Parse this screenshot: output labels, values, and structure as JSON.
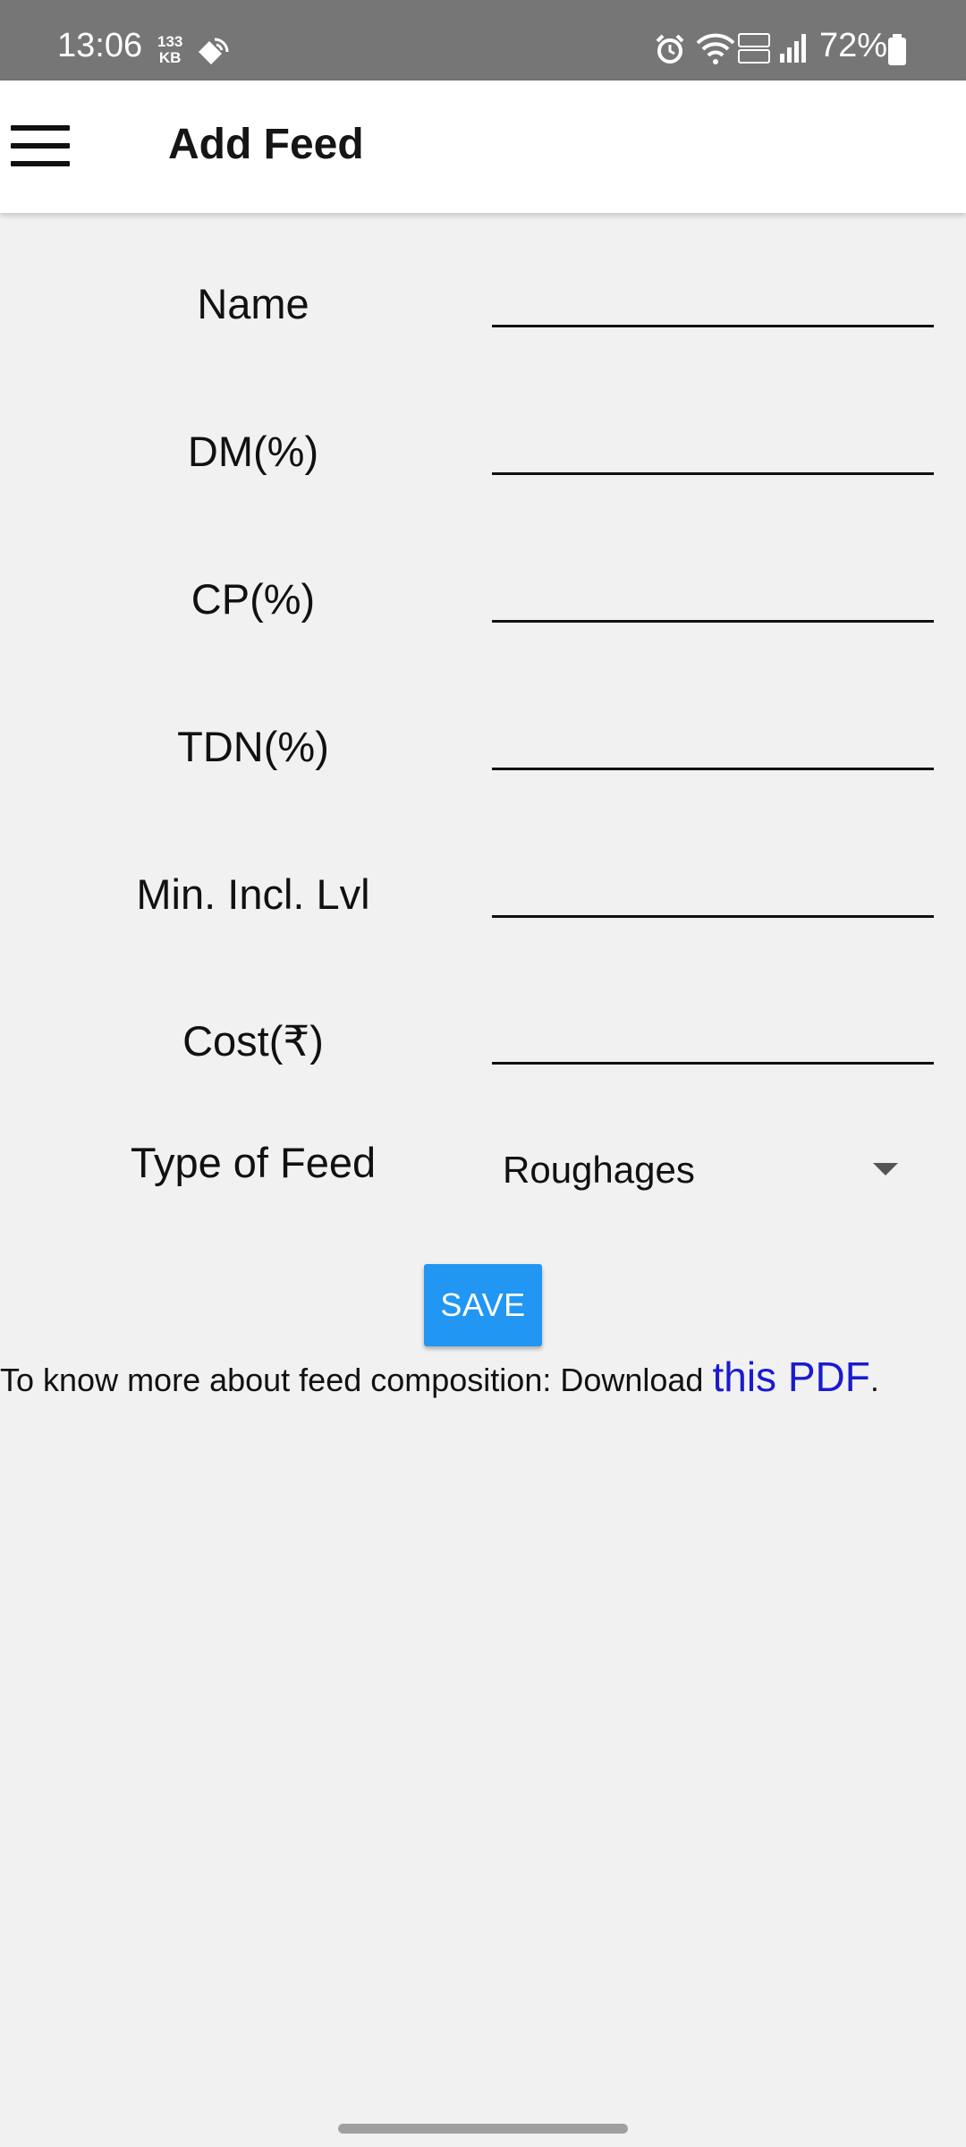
{
  "status_bar": {
    "time": "13:06",
    "data_rate_value": "133",
    "data_rate_unit": "KB",
    "battery_percent": "72%"
  },
  "app_bar": {
    "title": "Add Feed"
  },
  "form": {
    "fields": [
      {
        "label": "Name",
        "value": ""
      },
      {
        "label": "DM(%)",
        "value": ""
      },
      {
        "label": "CP(%)",
        "value": ""
      },
      {
        "label": "TDN(%)",
        "value": ""
      },
      {
        "label": "Min. Incl. Lvl",
        "value": ""
      },
      {
        "label": "Cost(₹)",
        "value": ""
      }
    ],
    "type_of_feed": {
      "label": "Type of Feed",
      "selected": "Roughages"
    },
    "save_label": "SAVE"
  },
  "info": {
    "prefix": "To know more about feed composition: Download ",
    "link_text": "this PDF",
    "suffix": "."
  },
  "colors": {
    "status_bar_bg": "#767676",
    "accent_button": "#2196f3",
    "link": "#1a1ad0",
    "page_bg": "#f1f1f1"
  }
}
